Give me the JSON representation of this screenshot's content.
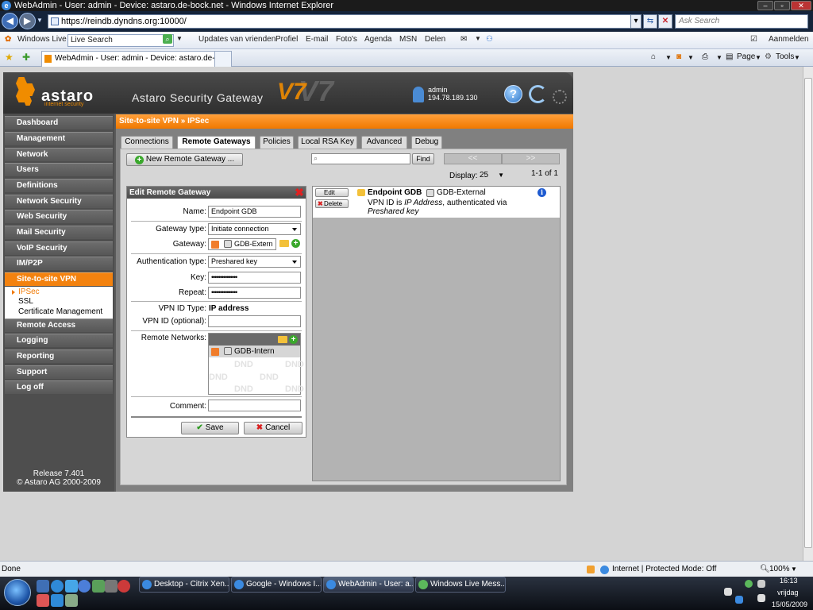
{
  "window": {
    "title": "WebAdmin - User: admin - Device: astaro.de-bock.net - Windows Internet Explorer",
    "url": "https://reindb.dyndns.org:10000/",
    "search_placeholder": "Ask Search"
  },
  "livebar": {
    "brand": "Windows Live",
    "search_placeholder": "Live Search",
    "links": [
      "Updates van vrienden",
      "Profiel",
      "E-mail",
      "Foto's",
      "Agenda",
      "MSN",
      "Delen"
    ],
    "signin": "Aanmelden"
  },
  "tabs_bar": {
    "tab_title": "WebAdmin - User: admin - Device: astaro.de-boc...",
    "page_menu": "Page",
    "tools_menu": "Tools"
  },
  "app": {
    "brand": "astaro",
    "brand_sub": "internet security",
    "product": "Astaro Security Gateway",
    "version_mark": "V7",
    "user_name": "admin",
    "user_ip": "194.78.189.130",
    "release": "Release 7.401",
    "copyright": "© Astaro AG 2000-2009"
  },
  "nav": {
    "items": [
      "Dashboard",
      "Management",
      "Network",
      "Users",
      "Definitions",
      "Network Security",
      "Web Security",
      "Mail Security",
      "VoIP Security",
      "IM/P2P",
      "Site-to-site VPN",
      "Remote Access",
      "Logging",
      "Reporting",
      "Support",
      "Log off"
    ],
    "active": "Site-to-site VPN",
    "sub_items": [
      "IPSec",
      "SSL",
      "Certificate Management"
    ],
    "sub_active": "IPSec"
  },
  "main": {
    "breadcrumb": "Site-to-site VPN » IPSec",
    "tabs": [
      "Connections",
      "Remote Gateways",
      "Policies",
      "Local RSA Key",
      "Advanced",
      "Debug"
    ],
    "active_tab": "Remote Gateways",
    "new_button": "New Remote Gateway ...",
    "find_button": "Find",
    "pager_prev": "<<",
    "pager_next": ">>",
    "display_label": "Display:",
    "display_value": "25",
    "count": "1-1 of 1"
  },
  "edit": {
    "title": "Edit Remote Gateway",
    "name_label": "Name:",
    "name_value": "Endpoint GDB",
    "gwtype_label": "Gateway type:",
    "gwtype_value": "Initiate connection",
    "gateway_label": "Gateway:",
    "gateway_value": "GDB-Extern",
    "auth_label": "Authentication type:",
    "auth_value": "Preshared key",
    "key_label": "Key:",
    "key_value": "•••••••••••••••",
    "repeat_label": "Repeat:",
    "repeat_value": "•••••••••••••••",
    "vpnid_type_label": "VPN ID Type:",
    "vpnid_type_value": "IP address",
    "vpnid_label": "VPN ID (optional):",
    "vpnid_value": "",
    "remote_nets_label": "Remote Networks:",
    "remote_net_item": "GDB-Intern",
    "dnd": "DND",
    "comment_label": "Comment:",
    "comment_value": "",
    "save": "Save",
    "cancel": "Cancel"
  },
  "list": {
    "edit_btn": "Edit",
    "delete_btn": "Delete",
    "name": "Endpoint GDB",
    "gateway": "GDB-External",
    "desc_prefix": "VPN ID is ",
    "desc_italic": "IP Address",
    "desc_suffix": ", authenticated via",
    "desc_line2": "Preshared key"
  },
  "status": {
    "left": "Done",
    "zone": "Internet | Protected Mode: Off",
    "zoom": "100%"
  },
  "taskbar": {
    "buttons": [
      "Desktop - Citrix Xen...",
      "Google - Windows I...",
      "WebAdmin - User: a...",
      "Windows Live Mess..."
    ],
    "time": "16:13",
    "day": "vrijdag",
    "date": "15/05/2009"
  },
  "colors": {
    "accent": "#f3820f",
    "app_dark": "#3b3b3b",
    "add_green": "#3aa82c",
    "close_red": "#e02020"
  }
}
